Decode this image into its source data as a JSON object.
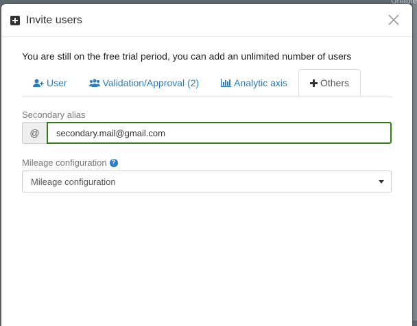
{
  "backdrop": {
    "corner_text": "Unable"
  },
  "modal": {
    "title": "Invite users",
    "intro": "You are still on the free trial period, you can add an unlimited number of users",
    "tabs": [
      {
        "label": "User",
        "icon": "user-plus-icon",
        "active": false
      },
      {
        "label": "Validation/Approval (2)",
        "icon": "users-icon",
        "active": false
      },
      {
        "label": "Analytic axis",
        "icon": "bar-chart-icon",
        "active": false
      },
      {
        "label": "Others",
        "icon": "plus-icon",
        "active": true
      }
    ],
    "secondary_alias": {
      "label": "Secondary alias",
      "addon": "@",
      "value": "secondary.mail@gmail.com"
    },
    "mileage": {
      "label": "Mileage configuration",
      "help_icon": "question-circle-icon",
      "selected": "Mileage configuration"
    }
  },
  "colors": {
    "link": "#2a7cc1",
    "focus_border": "#2e7d16"
  }
}
